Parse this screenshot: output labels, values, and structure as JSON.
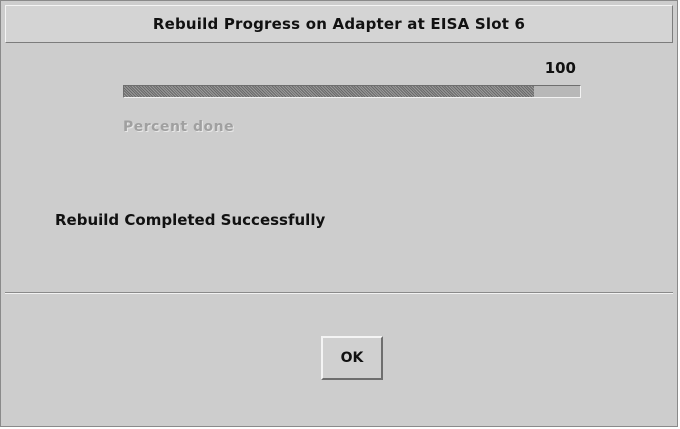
{
  "window": {
    "title": "Rebuild Progress on Adapter at EISA Slot 6"
  },
  "progress": {
    "value_text": "100",
    "fill_fraction": 0.9,
    "label": "Percent done"
  },
  "status": {
    "message": "Rebuild Completed Successfully"
  },
  "buttons": {
    "ok_label": "OK"
  }
}
